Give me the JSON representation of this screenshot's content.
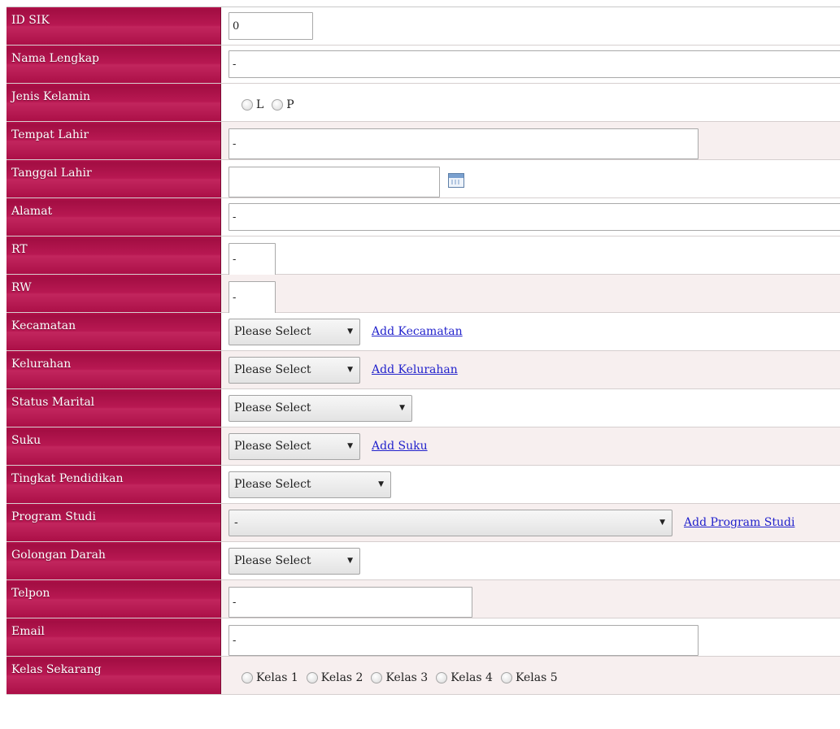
{
  "fields": {
    "id_sik": {
      "label": "ID SIK",
      "value": "0"
    },
    "nama_lengkap": {
      "label": "Nama Lengkap",
      "value": "-"
    },
    "jenis_kelamin": {
      "label": "Jenis Kelamin",
      "options": [
        "L",
        "P"
      ]
    },
    "tempat_lahir": {
      "label": "Tempat Lahir",
      "value": "-"
    },
    "tanggal_lahir": {
      "label": "Tanggal Lahir",
      "value": ""
    },
    "alamat": {
      "label": "Alamat",
      "value": "-"
    },
    "rt": {
      "label": "RT",
      "value": "-"
    },
    "rw": {
      "label": "RW",
      "value": "-"
    },
    "kecamatan": {
      "label": "Kecamatan",
      "selected": "Please Select",
      "link": "Add Kecamatan"
    },
    "kelurahan": {
      "label": "Kelurahan",
      "selected": "Please Select",
      "link": "Add Kelurahan"
    },
    "status_marital": {
      "label": "Status Marital",
      "selected": "Please Select"
    },
    "suku": {
      "label": "Suku",
      "selected": "Please Select",
      "link": "Add Suku"
    },
    "tingkat_pendidikan": {
      "label": "Tingkat Pendidikan",
      "selected": "Please Select"
    },
    "program_studi": {
      "label": "Program Studi",
      "selected": "-",
      "link": "Add Program Studi"
    },
    "golongan_darah": {
      "label": "Golongan Darah",
      "selected": "Please Select"
    },
    "telpon": {
      "label": "Telpon",
      "value": "-"
    },
    "email": {
      "label": "Email",
      "value": "-"
    },
    "kelas_sekarang": {
      "label": "Kelas Sekarang",
      "options": [
        "Kelas 1",
        "Kelas 2",
        "Kelas 3",
        "Kelas 4",
        "Kelas 5"
      ]
    }
  },
  "colors": {
    "label_bg": "#b3104a",
    "link": "#2222cc",
    "alt_row_bg": "#f7efef"
  },
  "icons": {
    "date_picker": "calendar-icon",
    "dropdown": "chevron-down-icon"
  }
}
